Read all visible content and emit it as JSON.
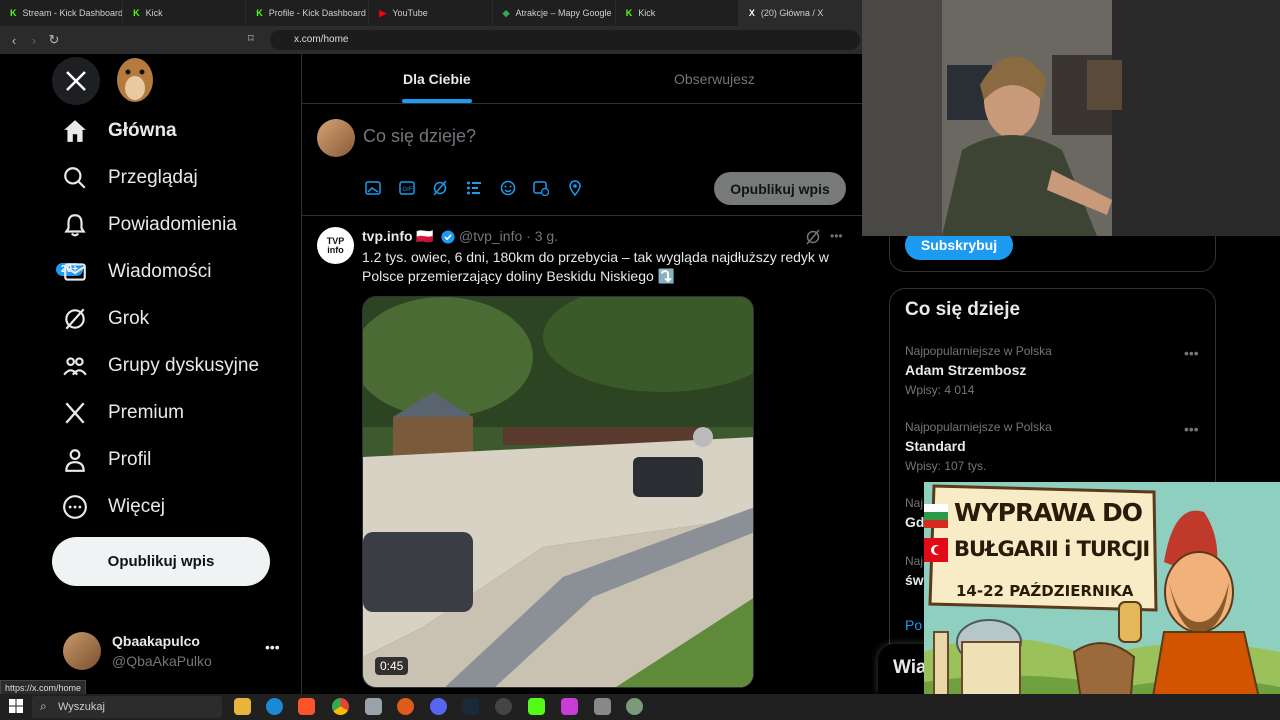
{
  "browser": {
    "tabs": [
      {
        "label": "Stream - Kick Dashboard",
        "icon": "K",
        "color": "#53fc18"
      },
      {
        "label": "Kick",
        "icon": "K",
        "color": "#53fc18"
      },
      {
        "label": "Profile - Kick Dashboard",
        "icon": "K",
        "color": "#53fc18"
      },
      {
        "label": "YouTube",
        "icon": "▶",
        "color": "#ff0000"
      },
      {
        "label": "Atrakcje – Mapy Google",
        "icon": "◆",
        "color": "#34a853"
      },
      {
        "label": "Kick",
        "icon": "K",
        "color": "#53fc18"
      },
      {
        "label": "(20) Główna / X",
        "icon": "X",
        "color": "#ffffff"
      }
    ],
    "url": "x.com/home",
    "status_url": "https://x.com/home"
  },
  "nav": {
    "items": [
      {
        "label": "Główna",
        "icon": "home-icon"
      },
      {
        "label": "Przeglądaj",
        "icon": "search-icon"
      },
      {
        "label": "Powiadomienia",
        "icon": "bell-icon"
      },
      {
        "label": "Wiadomości",
        "icon": "mail-icon"
      },
      {
        "label": "Grok",
        "icon": "grok-icon"
      },
      {
        "label": "Grupy dyskusyjne",
        "icon": "people-icon"
      },
      {
        "label": "Premium",
        "icon": "x-icon"
      },
      {
        "label": "Profil",
        "icon": "person-icon"
      },
      {
        "label": "Więcej",
        "icon": "more-icon"
      }
    ],
    "badge": "20+",
    "post_button": "Opublikuj wpis",
    "account": {
      "name": "Qbaakapulco",
      "handle": "@QbaAkaPulko"
    }
  },
  "main": {
    "tabs": [
      {
        "label": "Dla Ciebie"
      },
      {
        "label": "Obserwujesz"
      }
    ],
    "composer": {
      "placeholder": "Co się dzieje?",
      "post_button": "Opublikuj wpis"
    },
    "tweet": {
      "name": "tvp.info 🇵🇱",
      "handle": "@tvp_info · 3 g.",
      "avatar_text": "TVP\ninfo",
      "text": "1.2 tys. owiec, 6 dni, 180km do przebycia – tak wygląda najdłuższy redyk w Polsce przemierzający doliny Beskidu Niskiego ⤵️",
      "duration": "0:45"
    }
  },
  "right": {
    "subscribe_button": "Subskrybuj",
    "trends_title": "Co się dzieje",
    "trends": [
      {
        "category": "Najpopularniejsze w Polska",
        "name": "Adam Strzembosz",
        "count": "Wpisy: 4 014"
      },
      {
        "category": "Najpopularniejsze w Polska",
        "name": "Standard",
        "count": "Wpisy: 107 tys."
      },
      {
        "category": "Naj",
        "name": "Gd",
        "count": ""
      },
      {
        "category": "Naj",
        "name": "św",
        "count": ""
      }
    ],
    "show_more": "Po",
    "messages_label": "Wia"
  },
  "overlay": {
    "line1": "WYPRAWA DO",
    "line2": "BUŁGARII i TURCJI",
    "dates": "14-22 PAŹDZIERNIKA"
  },
  "taskbar": {
    "search": "Wyszukaj"
  }
}
